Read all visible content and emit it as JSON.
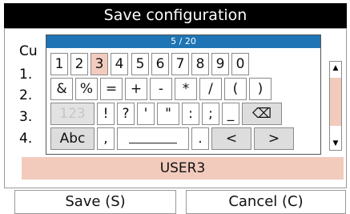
{
  "dialog": {
    "title": "Save configuration"
  },
  "list": {
    "header_partial": "Cu",
    "rows": [
      "1.",
      "2.",
      "3.",
      "4."
    ]
  },
  "keyboard": {
    "counter": "5 / 20",
    "row1": [
      "1",
      "2",
      "3",
      "4",
      "5",
      "6",
      "7",
      "8",
      "9",
      "0"
    ],
    "row2": [
      "&",
      "%",
      "=",
      "+",
      "-",
      "*",
      "/",
      "(",
      ")"
    ],
    "row3": [
      "123",
      "!",
      "?",
      "'",
      "\"",
      ":",
      ";",
      "_",
      "⌫"
    ],
    "row4": {
      "mode": "Abc",
      "comma": ",",
      "space": "",
      "period": ".",
      "left": "<",
      "right": ">"
    },
    "selected_key": "3"
  },
  "scrollbar": {
    "up_arrow": "▲",
    "down_arrow": "▼"
  },
  "input": {
    "value": "USER3"
  },
  "buttons": {
    "save": "Save (S)",
    "cancel": "Cancel (C)"
  }
}
